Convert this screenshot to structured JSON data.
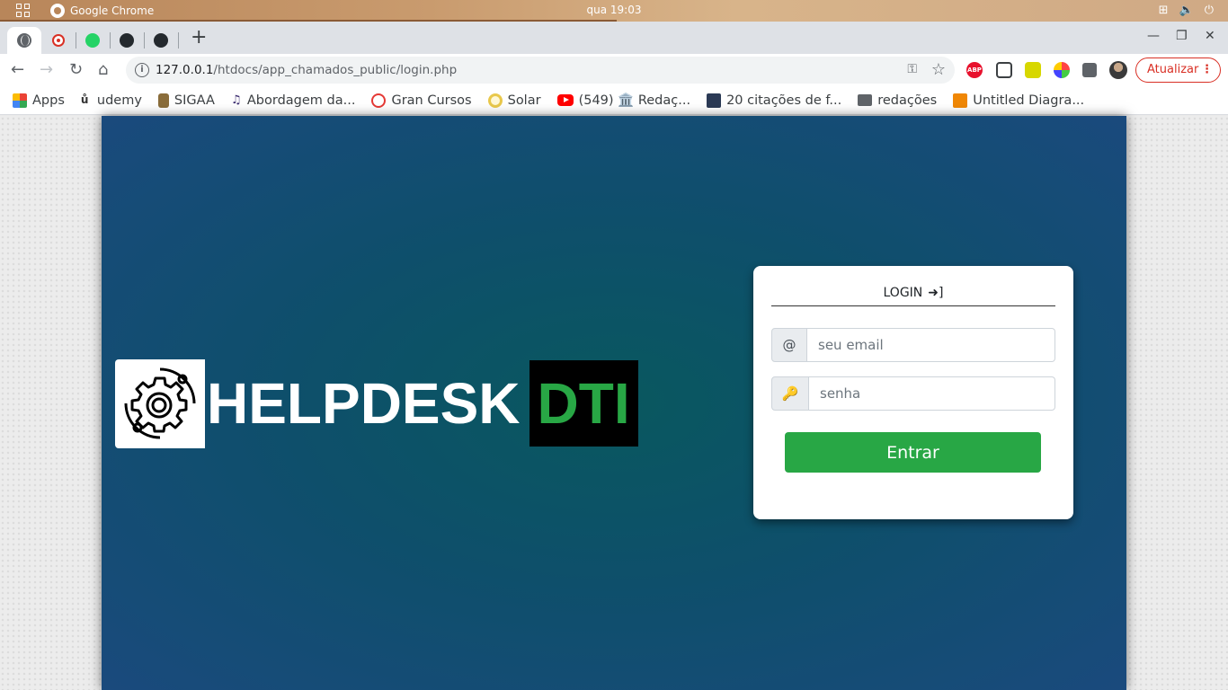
{
  "os_bar": {
    "app_name": "Google Chrome",
    "clock": "qua 19:03"
  },
  "browser": {
    "tabs": [
      "globe",
      "record",
      "whatsapp",
      "github",
      "github"
    ],
    "new_tab": "+",
    "url_host": "127.0.0.1",
    "url_path": "/htdocs/app_chamados_public/login.php",
    "update_label": "Atualizar",
    "update_menu": "⋮"
  },
  "bookmarks": [
    {
      "label": "Apps",
      "icon": "apps-icon"
    },
    {
      "label": "udemy",
      "icon": "udemy-icon"
    },
    {
      "label": "SIGAA",
      "icon": "sigaa-icon"
    },
    {
      "label": "Abordagem da...",
      "icon": "music-icon"
    },
    {
      "label": "Gran Cursos",
      "icon": "gran-cursos-icon"
    },
    {
      "label": "Solar",
      "icon": "solar-icon"
    },
    {
      "label": "(549) 🏛️ Redaç...",
      "icon": "youtube-icon"
    },
    {
      "label": "20 citações de f...",
      "icon": "citacoes-icon"
    },
    {
      "label": "redações",
      "icon": "folder-icon"
    },
    {
      "label": "Untitled Diagra...",
      "icon": "diagram-icon"
    }
  ],
  "logo": {
    "brand": "HELPDESK",
    "brand_accent": "DTI"
  },
  "login": {
    "title": "LOGIN",
    "email_addon": "@",
    "email_placeholder": "seu email",
    "password_placeholder": "senha",
    "submit_label": "Entrar"
  },
  "colors": {
    "accent": "#28a745",
    "hero_dark": "#1a4a7d",
    "hero_center": "#09585f"
  }
}
